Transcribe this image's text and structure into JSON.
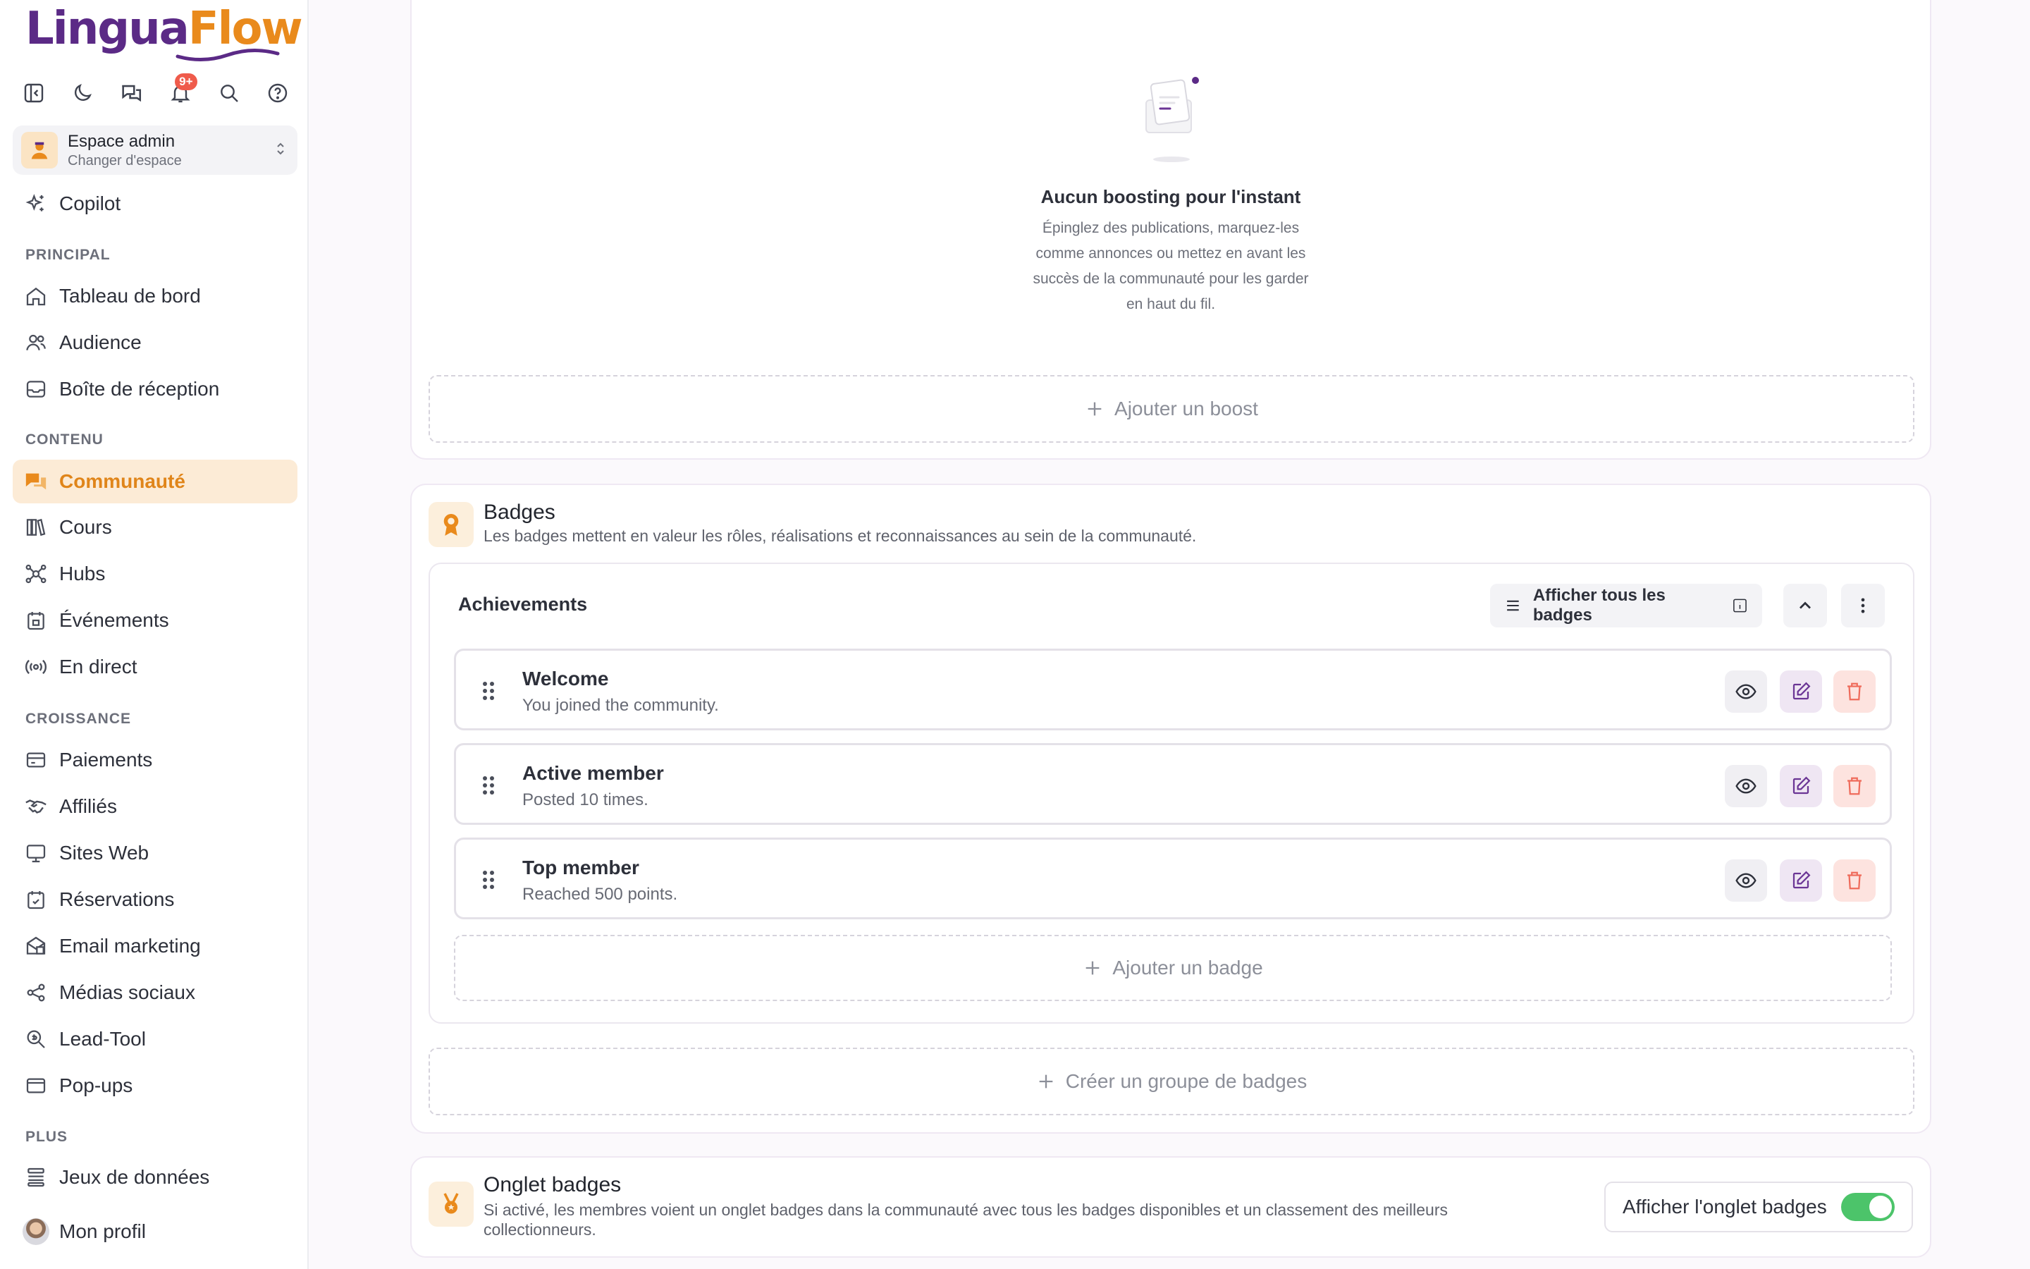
{
  "app": {
    "logo_part1": "Lingua",
    "logo_part2": "Flow",
    "notifications_count": "9+"
  },
  "workspace": {
    "title": "Espace admin",
    "subtitle": "Changer d'espace"
  },
  "nav": {
    "copilot": "Copilot",
    "sections": {
      "principal": "PRINCIPAL",
      "contenu": "CONTENU",
      "croissance": "CROISSANCE",
      "plus": "PLUS"
    },
    "items": {
      "tableau": "Tableau de bord",
      "audience": "Audience",
      "boite": "Boîte de réception",
      "communaute": "Communauté",
      "cours": "Cours",
      "hubs": "Hubs",
      "evenements": "Événements",
      "direct": "En direct",
      "paiements": "Paiements",
      "affilies": "Affiliés",
      "sites": "Sites Web",
      "reservations": "Réservations",
      "email": "Email marketing",
      "medias": "Médias sociaux",
      "lead": "Lead-Tool",
      "popups": "Pop-ups",
      "jeux": "Jeux de données",
      "profil": "Mon profil"
    }
  },
  "boosting": {
    "empty_title": "Aucun boosting pour l'instant",
    "empty_desc": "Épinglez des publications, marquez-les comme annonces ou mettez en avant les succès de la communauté pour les garder en haut du fil.",
    "add_button": "Ajouter un boost"
  },
  "badges": {
    "title": "Badges",
    "description": "Les badges mettent en valeur les rôles, réalisations et reconnaissances au sein de la communauté.",
    "group": {
      "name": "Achievements",
      "show_all": "Afficher tous les badges",
      "items": [
        {
          "name": "Welcome",
          "desc": "You joined the community."
        },
        {
          "name": "Active member",
          "desc": "Posted 10 times."
        },
        {
          "name": "Top member",
          "desc": "Reached 500 points."
        }
      ],
      "add_badge": "Ajouter un badge"
    },
    "create_group": "Créer un groupe de badges"
  },
  "badges_tab": {
    "title": "Onglet badges",
    "description": "Si activé, les membres voient un onglet badges dans la communauté avec tous les badges disponibles et un classement des meilleurs collectionneurs.",
    "toggle_label": "Afficher l'onglet badges",
    "toggle_on": true
  },
  "colors": {
    "brand_purple": "#5b2a86",
    "brand_orange": "#e98a1c",
    "toggle_green": "#4cc46a",
    "delete_red": "#ef6b5b"
  }
}
